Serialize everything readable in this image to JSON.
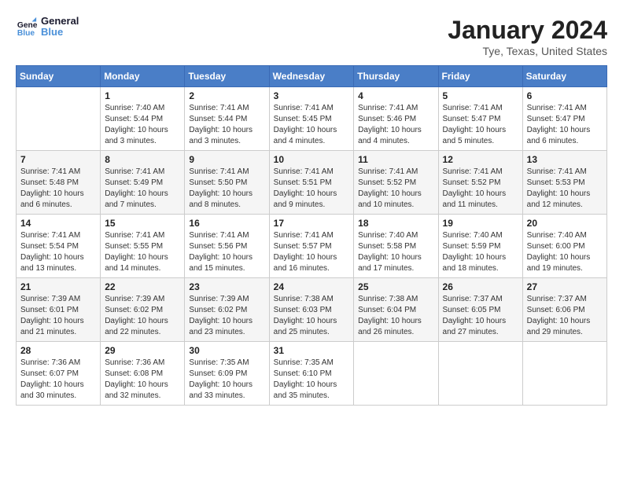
{
  "header": {
    "logo_line1": "General",
    "logo_line2": "Blue",
    "main_title": "January 2024",
    "subtitle": "Tye, Texas, United States"
  },
  "weekdays": [
    "Sunday",
    "Monday",
    "Tuesday",
    "Wednesday",
    "Thursday",
    "Friday",
    "Saturday"
  ],
  "weeks": [
    [
      {
        "day": "",
        "info": ""
      },
      {
        "day": "1",
        "info": "Sunrise: 7:40 AM\nSunset: 5:44 PM\nDaylight: 10 hours\nand 3 minutes."
      },
      {
        "day": "2",
        "info": "Sunrise: 7:41 AM\nSunset: 5:44 PM\nDaylight: 10 hours\nand 3 minutes."
      },
      {
        "day": "3",
        "info": "Sunrise: 7:41 AM\nSunset: 5:45 PM\nDaylight: 10 hours\nand 4 minutes."
      },
      {
        "day": "4",
        "info": "Sunrise: 7:41 AM\nSunset: 5:46 PM\nDaylight: 10 hours\nand 4 minutes."
      },
      {
        "day": "5",
        "info": "Sunrise: 7:41 AM\nSunset: 5:47 PM\nDaylight: 10 hours\nand 5 minutes."
      },
      {
        "day": "6",
        "info": "Sunrise: 7:41 AM\nSunset: 5:47 PM\nDaylight: 10 hours\nand 6 minutes."
      }
    ],
    [
      {
        "day": "7",
        "info": "Sunrise: 7:41 AM\nSunset: 5:48 PM\nDaylight: 10 hours\nand 6 minutes."
      },
      {
        "day": "8",
        "info": "Sunrise: 7:41 AM\nSunset: 5:49 PM\nDaylight: 10 hours\nand 7 minutes."
      },
      {
        "day": "9",
        "info": "Sunrise: 7:41 AM\nSunset: 5:50 PM\nDaylight: 10 hours\nand 8 minutes."
      },
      {
        "day": "10",
        "info": "Sunrise: 7:41 AM\nSunset: 5:51 PM\nDaylight: 10 hours\nand 9 minutes."
      },
      {
        "day": "11",
        "info": "Sunrise: 7:41 AM\nSunset: 5:52 PM\nDaylight: 10 hours\nand 10 minutes."
      },
      {
        "day": "12",
        "info": "Sunrise: 7:41 AM\nSunset: 5:52 PM\nDaylight: 10 hours\nand 11 minutes."
      },
      {
        "day": "13",
        "info": "Sunrise: 7:41 AM\nSunset: 5:53 PM\nDaylight: 10 hours\nand 12 minutes."
      }
    ],
    [
      {
        "day": "14",
        "info": "Sunrise: 7:41 AM\nSunset: 5:54 PM\nDaylight: 10 hours\nand 13 minutes."
      },
      {
        "day": "15",
        "info": "Sunrise: 7:41 AM\nSunset: 5:55 PM\nDaylight: 10 hours\nand 14 minutes."
      },
      {
        "day": "16",
        "info": "Sunrise: 7:41 AM\nSunset: 5:56 PM\nDaylight: 10 hours\nand 15 minutes."
      },
      {
        "day": "17",
        "info": "Sunrise: 7:41 AM\nSunset: 5:57 PM\nDaylight: 10 hours\nand 16 minutes."
      },
      {
        "day": "18",
        "info": "Sunrise: 7:40 AM\nSunset: 5:58 PM\nDaylight: 10 hours\nand 17 minutes."
      },
      {
        "day": "19",
        "info": "Sunrise: 7:40 AM\nSunset: 5:59 PM\nDaylight: 10 hours\nand 18 minutes."
      },
      {
        "day": "20",
        "info": "Sunrise: 7:40 AM\nSunset: 6:00 PM\nDaylight: 10 hours\nand 19 minutes."
      }
    ],
    [
      {
        "day": "21",
        "info": "Sunrise: 7:39 AM\nSunset: 6:01 PM\nDaylight: 10 hours\nand 21 minutes."
      },
      {
        "day": "22",
        "info": "Sunrise: 7:39 AM\nSunset: 6:02 PM\nDaylight: 10 hours\nand 22 minutes."
      },
      {
        "day": "23",
        "info": "Sunrise: 7:39 AM\nSunset: 6:02 PM\nDaylight: 10 hours\nand 23 minutes."
      },
      {
        "day": "24",
        "info": "Sunrise: 7:38 AM\nSunset: 6:03 PM\nDaylight: 10 hours\nand 25 minutes."
      },
      {
        "day": "25",
        "info": "Sunrise: 7:38 AM\nSunset: 6:04 PM\nDaylight: 10 hours\nand 26 minutes."
      },
      {
        "day": "26",
        "info": "Sunrise: 7:37 AM\nSunset: 6:05 PM\nDaylight: 10 hours\nand 27 minutes."
      },
      {
        "day": "27",
        "info": "Sunrise: 7:37 AM\nSunset: 6:06 PM\nDaylight: 10 hours\nand 29 minutes."
      }
    ],
    [
      {
        "day": "28",
        "info": "Sunrise: 7:36 AM\nSunset: 6:07 PM\nDaylight: 10 hours\nand 30 minutes."
      },
      {
        "day": "29",
        "info": "Sunrise: 7:36 AM\nSunset: 6:08 PM\nDaylight: 10 hours\nand 32 minutes."
      },
      {
        "day": "30",
        "info": "Sunrise: 7:35 AM\nSunset: 6:09 PM\nDaylight: 10 hours\nand 33 minutes."
      },
      {
        "day": "31",
        "info": "Sunrise: 7:35 AM\nSunset: 6:10 PM\nDaylight: 10 hours\nand 35 minutes."
      },
      {
        "day": "",
        "info": ""
      },
      {
        "day": "",
        "info": ""
      },
      {
        "day": "",
        "info": ""
      }
    ]
  ]
}
